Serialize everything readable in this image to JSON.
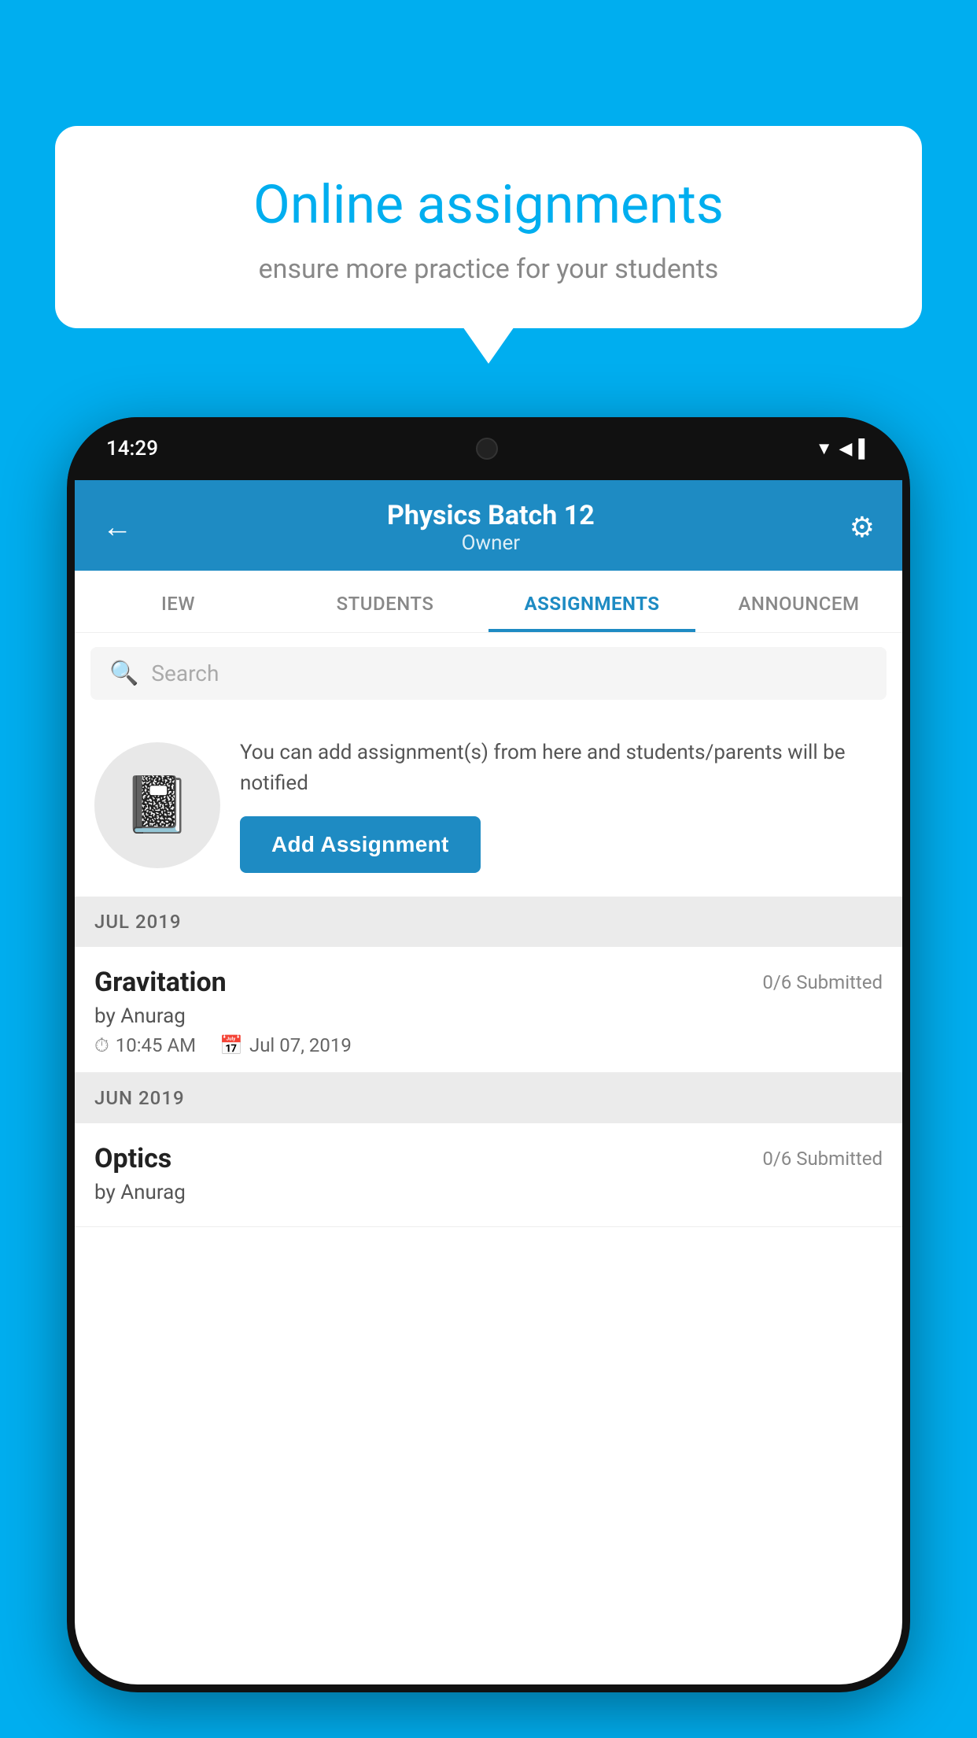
{
  "background": {
    "color": "#00AEEF"
  },
  "speech_bubble": {
    "title": "Online assignments",
    "subtitle": "ensure more practice for your students"
  },
  "phone": {
    "status_bar": {
      "time": "14:29",
      "icons": [
        "▼",
        "◀",
        "▌"
      ]
    },
    "header": {
      "title": "Physics Batch 12",
      "subtitle": "Owner",
      "back_label": "←",
      "settings_label": "⚙"
    },
    "tabs": [
      {
        "label": "IEW",
        "active": false
      },
      {
        "label": "STUDENTS",
        "active": false
      },
      {
        "label": "ASSIGNMENTS",
        "active": true
      },
      {
        "label": "ANNOUNCEM",
        "active": false
      }
    ],
    "search": {
      "placeholder": "Search"
    },
    "info_box": {
      "text": "You can add assignment(s) from here and students/parents will be notified",
      "button_label": "Add Assignment"
    },
    "sections": [
      {
        "header": "JUL 2019",
        "items": [
          {
            "name": "Gravitation",
            "submitted": "0/6 Submitted",
            "author": "by Anurag",
            "time": "10:45 AM",
            "date": "Jul 07, 2019"
          }
        ]
      },
      {
        "header": "JUN 2019",
        "items": [
          {
            "name": "Optics",
            "submitted": "0/6 Submitted",
            "author": "by Anurag",
            "time": "",
            "date": ""
          }
        ]
      }
    ]
  }
}
